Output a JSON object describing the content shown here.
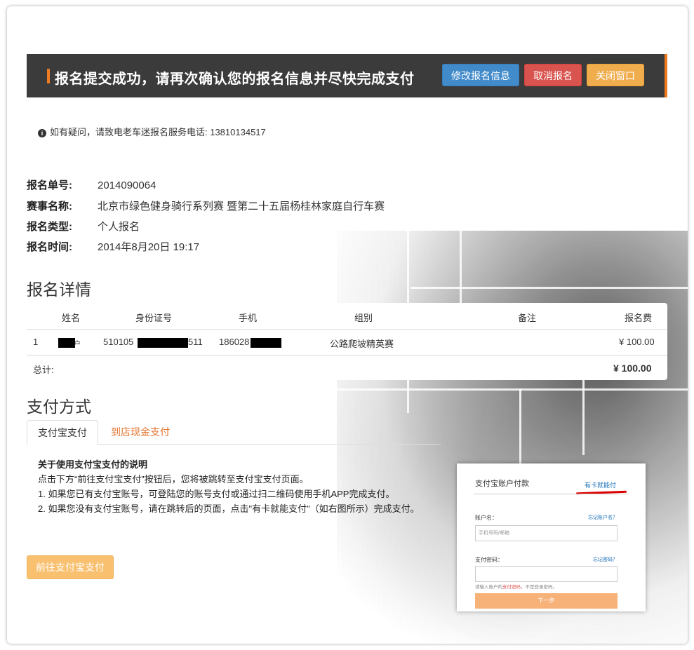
{
  "header": {
    "title": "报名提交成功，请再次确认您的报名信息并尽快完成支付",
    "buttons": {
      "edit": "修改报名信息",
      "cancel": "取消报名",
      "close": "关闭窗口"
    }
  },
  "notice": "如有疑问，请致电老车迷报名服务电话: 13810134517",
  "info": {
    "order_label": "报名单号:",
    "order_value": "2014090064",
    "event_label": "赛事名称:",
    "event_value": "北京市绿色健身骑行系列赛 暨第二十五届杨桂林家庭自行车赛",
    "type_label": "报名类型:",
    "type_value": "个人报名",
    "time_label": "报名时间:",
    "time_value": "2014年8月20日 19:17"
  },
  "details": {
    "title": "报名详情",
    "columns": [
      "姓名",
      "身份证号",
      "手机",
      "组别",
      "备注",
      "报名费"
    ],
    "row": {
      "index": "1",
      "name_tail": "户",
      "id_prefix": "510105",
      "id_suffix": "511",
      "phone_prefix": "186028",
      "group": "公路爬坡精英赛",
      "note": "",
      "fee": "¥ 100.00"
    },
    "total_label": "总计:",
    "total_value": "¥ 100.00"
  },
  "payment": {
    "title": "支付方式",
    "tabs": [
      "支付宝支付",
      "到店现金支付"
    ],
    "instructions_title": "关于使用支付宝支付的说明",
    "instructions": [
      "点击下方“前往支付宝支付”按钮后，您将被跳转至支付宝支付页面。",
      "1. 如果您已有支付宝账号，可登陆您的账号支付或通过扫二维码使用手机APP完成支付。",
      "2. 如果您没有支付宝账号，请在跳转后的页面，点击\"有卡就能支付\"（如右图所示）完成支付。"
    ],
    "button": "前往支付宝支付"
  },
  "alipay": {
    "title": "支付宝账户付款",
    "card_link": "有卡就能付",
    "account_label": "账户名：",
    "forgot_account": "忘记账户名？",
    "account_placeholder": "手机号码/邮箱",
    "password_label": "支付密码：",
    "forgot_password": "忘记密码？",
    "hint_before": "请输入账户的",
    "hint_red": "支付密码",
    "hint_after": "，不是登录密码。",
    "next": "下一步"
  },
  "colors": {
    "accent": "#f07c22",
    "blue": "#428bca",
    "red": "#d9534f",
    "orange": "#f0ad4e",
    "dark": "#3b3b3b"
  }
}
